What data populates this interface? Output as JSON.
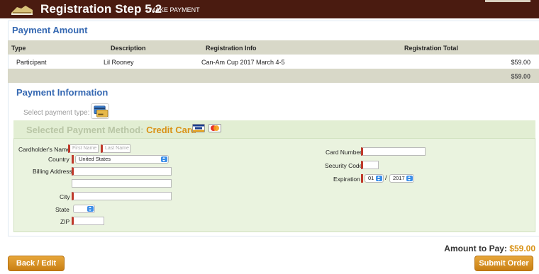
{
  "header": {
    "title": "Registration Step 5.2",
    "subtitle": "- MAKE PAYMENT"
  },
  "payment_amount": {
    "title": "Payment Amount",
    "columns": [
      "Type",
      "Description",
      "Registration Info",
      "Registration Total"
    ],
    "rows": [
      {
        "type": "Participant",
        "description": "Lil Rooney",
        "info": "Can-Am Cup 2017 March 4-5",
        "total": "$59.00"
      }
    ],
    "grand_total": "$59.00"
  },
  "payment_info": {
    "title": "Payment Information",
    "select_type_label": "Select payment type:",
    "method_label": "Selected Payment Method:",
    "method_value": "Credit Card"
  },
  "form": {
    "cardholder_label": "Cardholder's Name",
    "first_name_placeholder": "First Name",
    "last_name_placeholder": "Last Name",
    "country_label": "Country",
    "country_value": "United States",
    "billing_label": "Billing Address",
    "city_label": "City",
    "state_label": "State",
    "zip_label": "ZIP",
    "card_number_label": "Card Number",
    "security_code_label": "Security Code",
    "expiration_label": "Expiration",
    "exp_month": "01",
    "exp_separator": "/",
    "exp_year": "2017"
  },
  "footer": {
    "amount_label": "Amount to Pay:",
    "amount_value": "$59.00",
    "back_label": "Back / Edit",
    "submit_label": "Submit Order"
  },
  "colors": {
    "header_bg": "#4a1b10",
    "accent_blue": "#3568b2",
    "accent_orange": "#d99318",
    "method_bg": "#eaf3df",
    "required": "#c0392b"
  },
  "icons": [
    "shoe-logo-icon",
    "credit-card-icon",
    "visa-icon",
    "mastercard-icon",
    "chevron-updown-icon"
  ]
}
